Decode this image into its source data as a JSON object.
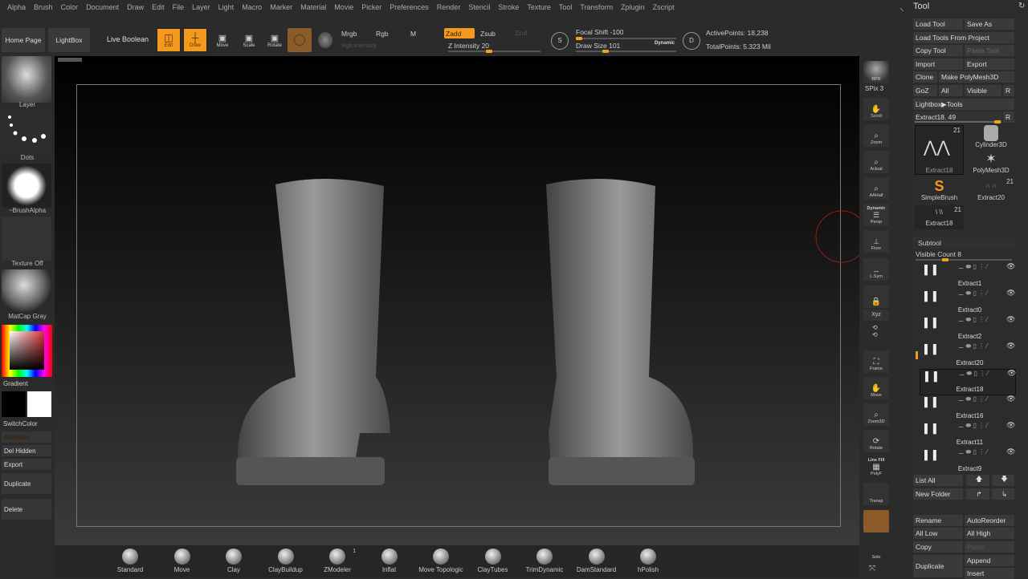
{
  "menu": [
    "Alpha",
    "Brush",
    "Color",
    "Document",
    "Draw",
    "Edit",
    "File",
    "Layer",
    "Light",
    "Macro",
    "Marker",
    "Material",
    "Movie",
    "Picker",
    "Preferences",
    "Render",
    "Stencil",
    "Stroke",
    "Texture",
    "Tool",
    "Transform",
    "Zplugin",
    "Zscript"
  ],
  "toolbar": {
    "home_page": "Home Page",
    "lightbox": "LightBox",
    "live_boolean": "Live Boolean",
    "edit": "Edit",
    "draw": "Draw",
    "move": "Move",
    "scale": "Scale",
    "rotate": "Rotate",
    "mrgb": "Mrgb",
    "rgb": "Rgb",
    "m": "M",
    "rgb_intensity": "Rgb Intensity",
    "zadd": "Zadd",
    "zsub": "Zsub",
    "zcut": "Zcut",
    "z_intensity": "Z Intensity 20",
    "z_intensity_value": 20,
    "focal_shift": "Focal Shift -100",
    "focal_shift_value": -100,
    "draw_size": "Draw Size 101",
    "draw_size_value": 101,
    "dynamic": "Dynamic",
    "active_points": "ActivePoints: 18,238",
    "total_points": "TotalPoints: 5.323 Mil"
  },
  "left": {
    "layer": "Layer",
    "dots": "Dots",
    "brush_alpha": "~BrushAlpha",
    "texture_off": "Texture Off",
    "matcap": "MatCap Gray",
    "gradient": "Gradient",
    "switch_color": "SwitchColor",
    "alternate": "Alternate",
    "del_hidden": "Del Hidden",
    "export": "Export",
    "duplicate": "Duplicate",
    "delete": "Delete"
  },
  "right_icons": [
    "BPR",
    "SPix 3",
    "Scroll",
    "Zoom",
    "Actual",
    "AAHalf",
    "Persp",
    "Floor",
    "L.Sym",
    "Frame",
    "Move",
    "Zoom3D",
    "Rotate",
    "PolyF",
    "Transp",
    "Solo"
  ],
  "right_icon_extra": {
    "dynamic": "Dynamic",
    "line_fill": "Line Fill",
    "xyz": "Xyz"
  },
  "tool_panel": {
    "title": "Tool",
    "load_tool": "Load Tool",
    "save_as": "Save As",
    "load_from_project": "Load Tools From Project",
    "copy_tool": "Copy Tool",
    "paste_tool": "Paste Tool",
    "import": "Import",
    "export": "Export",
    "clone": "Clone",
    "make_polymesh": "Make PolyMesh3D",
    "goz": "GoZ",
    "all": "All",
    "visible": "Visible",
    "r": "R",
    "lightbox_tools": "Lightbox▶Tools",
    "current_tool": "Extract18. 49",
    "thumbs": [
      {
        "name": "Extract18",
        "count": "21"
      },
      {
        "name": "Cylinder3D"
      },
      {
        "name": "PolyMesh3D"
      },
      {
        "name": "SimpleBrush"
      },
      {
        "name": "Extract20",
        "count": "21"
      },
      {
        "name": "Extract18",
        "count": "21"
      }
    ]
  },
  "subtool": {
    "title": "Subtool",
    "visible_count": "Visible Count 8",
    "items": [
      "Extract1",
      "Extract0",
      "Extract2",
      "Extract20",
      "Extract18",
      "Extract16",
      "Extract11",
      "Extract9"
    ],
    "selected": "Extract18",
    "list_all": "List All",
    "new_folder": "New Folder",
    "rename": "Rename",
    "auto_reorder": "AutoReorder",
    "all_low": "All Low",
    "all_high": "All High",
    "copy": "Copy",
    "paste": "Paste",
    "duplicate": "Duplicate",
    "append": "Append",
    "insert": "Insert"
  },
  "brushes": [
    {
      "name": "Standard"
    },
    {
      "name": "Move"
    },
    {
      "name": "Clay"
    },
    {
      "name": "ClayBuildup"
    },
    {
      "name": "ZModeler",
      "badge": "1"
    },
    {
      "name": "Inflat"
    },
    {
      "name": "Move Topologic"
    },
    {
      "name": "ClayTubes"
    },
    {
      "name": "TrimDynamic"
    },
    {
      "name": "DamStandard"
    },
    {
      "name": "hPolish"
    }
  ],
  "colors": {
    "accent": "#f39a1e",
    "bg": "#2b2b2b"
  }
}
